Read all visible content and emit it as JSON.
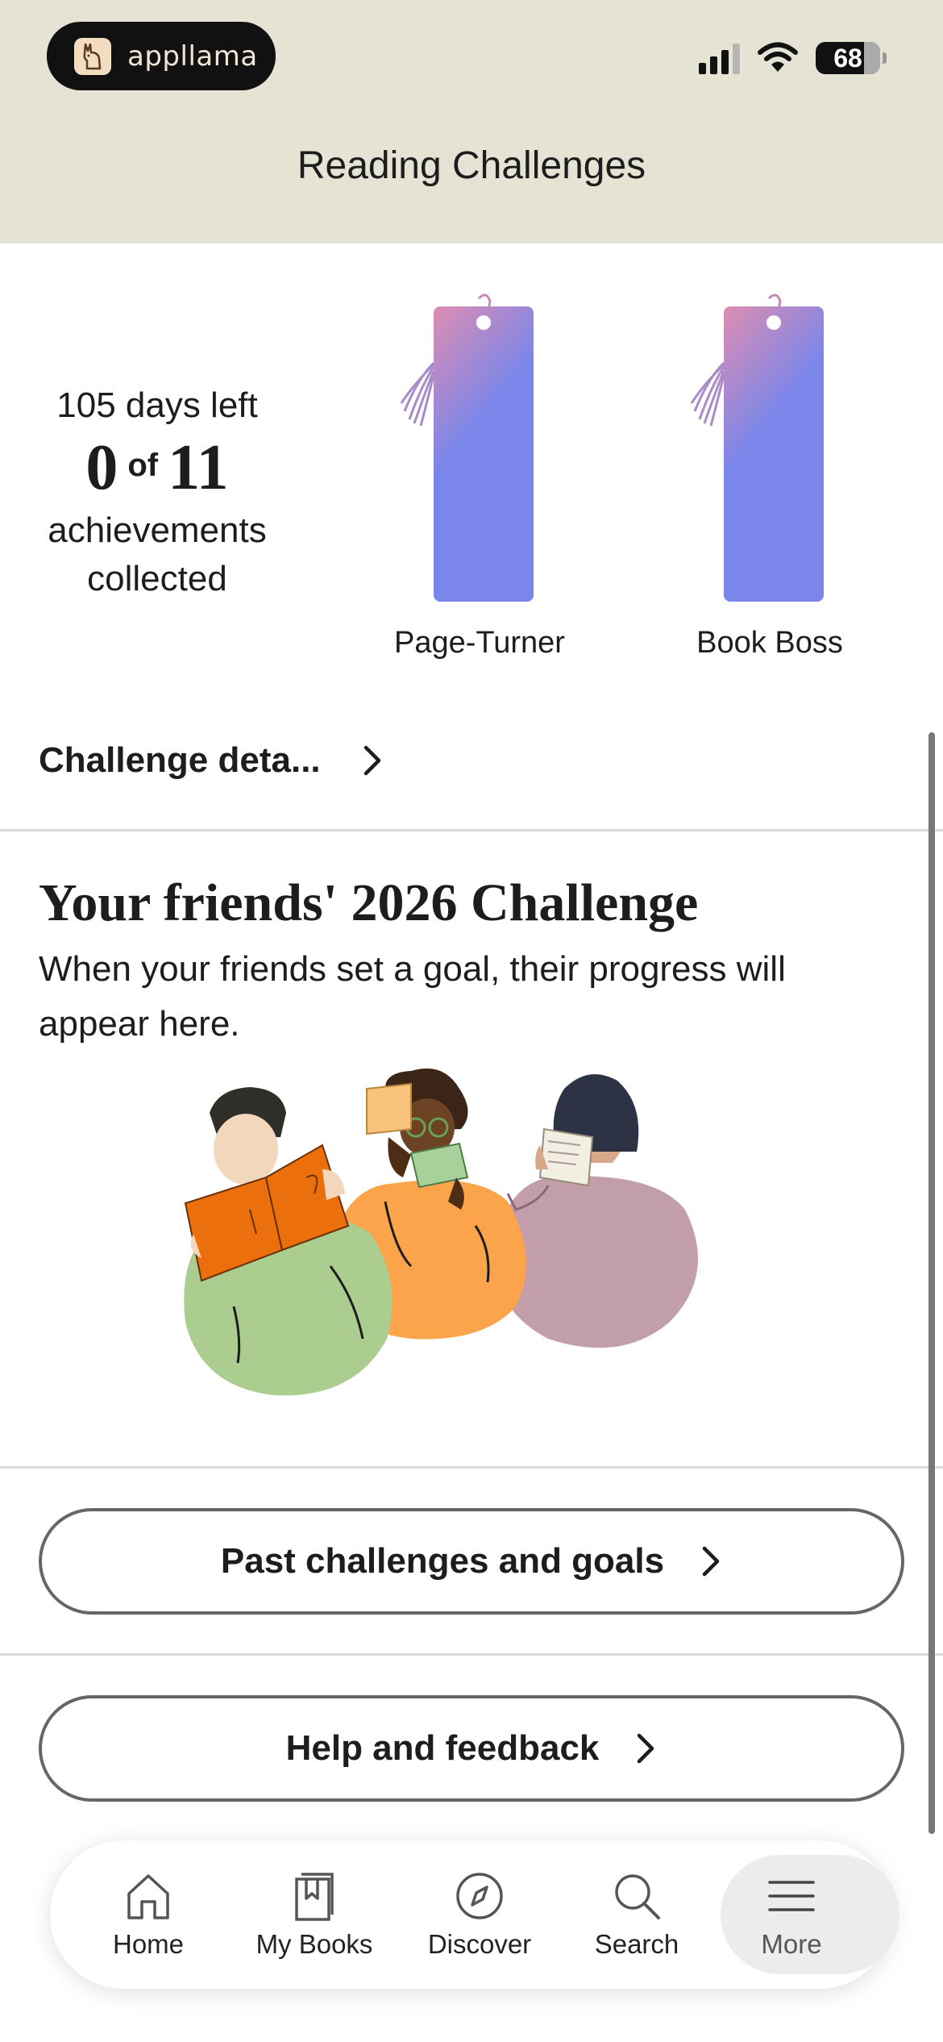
{
  "status_bar": {
    "brand": "appllama",
    "battery": "68"
  },
  "header": {
    "title": "Reading Challenges"
  },
  "challenge": {
    "days_left": "105 days left",
    "collected": "0",
    "of": "of",
    "total": "11",
    "achievements_line1": "achievements",
    "achievements_line2": "collected",
    "badges": [
      {
        "label": "Page-Turner"
      },
      {
        "label": "Book Boss"
      }
    ],
    "details_link": "Challenge deta..."
  },
  "friends": {
    "title": "Your friends' 2026 Challenge",
    "description": "When your friends set a goal, their progress will appear here."
  },
  "buttons": {
    "past": "Past challenges and goals",
    "help": "Help and feedback"
  },
  "tabs": [
    {
      "label": "Home",
      "icon": "home-icon"
    },
    {
      "label": "My Books",
      "icon": "bookmark-icon"
    },
    {
      "label": "Discover",
      "icon": "compass-icon"
    },
    {
      "label": "Search",
      "icon": "search-icon"
    },
    {
      "label": "More",
      "icon": "menu-icon",
      "active": true
    }
  ],
  "colors": {
    "header_bg": "#e5e3d3",
    "bookmark_top": "#dd8db2",
    "bookmark_bottom": "#7a86ea"
  }
}
